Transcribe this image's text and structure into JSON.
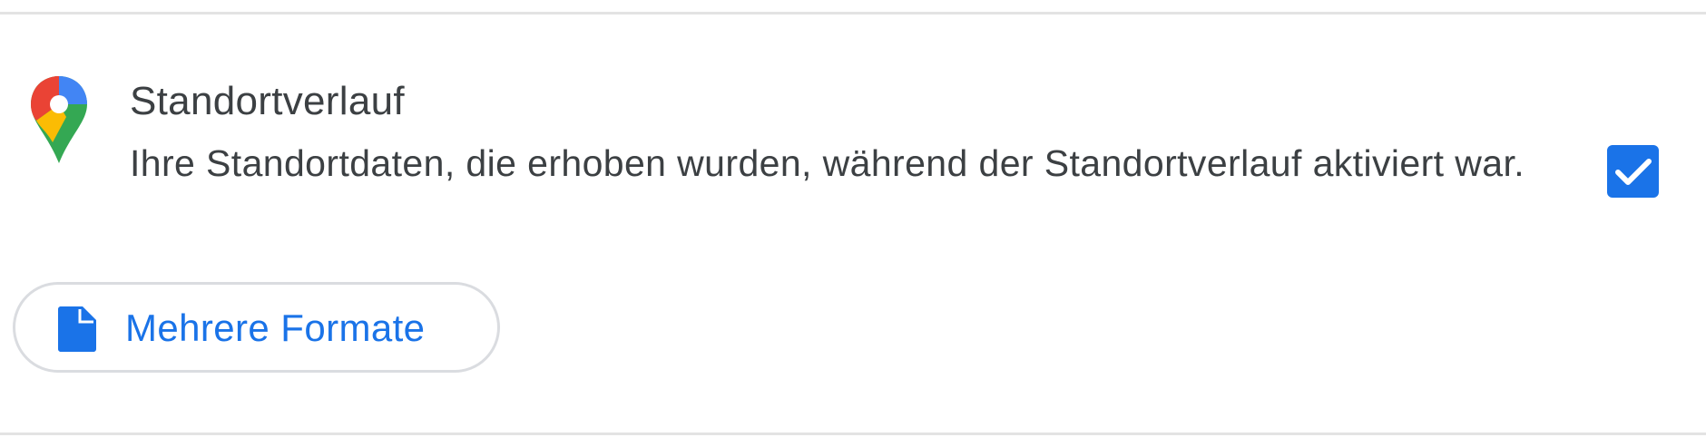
{
  "item": {
    "title": "Standortverlauf",
    "description": "Ihre Standortdaten, die erhoben wurden, während der Standortverlauf aktiviert war.",
    "icon": "google-maps-pin-icon",
    "checked": true
  },
  "format_button": {
    "label": "Mehrere Formate",
    "icon": "file-icon"
  },
  "colors": {
    "accent": "#1a73e8",
    "text": "#3c4043",
    "divider": "#e3e3e3",
    "button_border": "#dadce0"
  }
}
